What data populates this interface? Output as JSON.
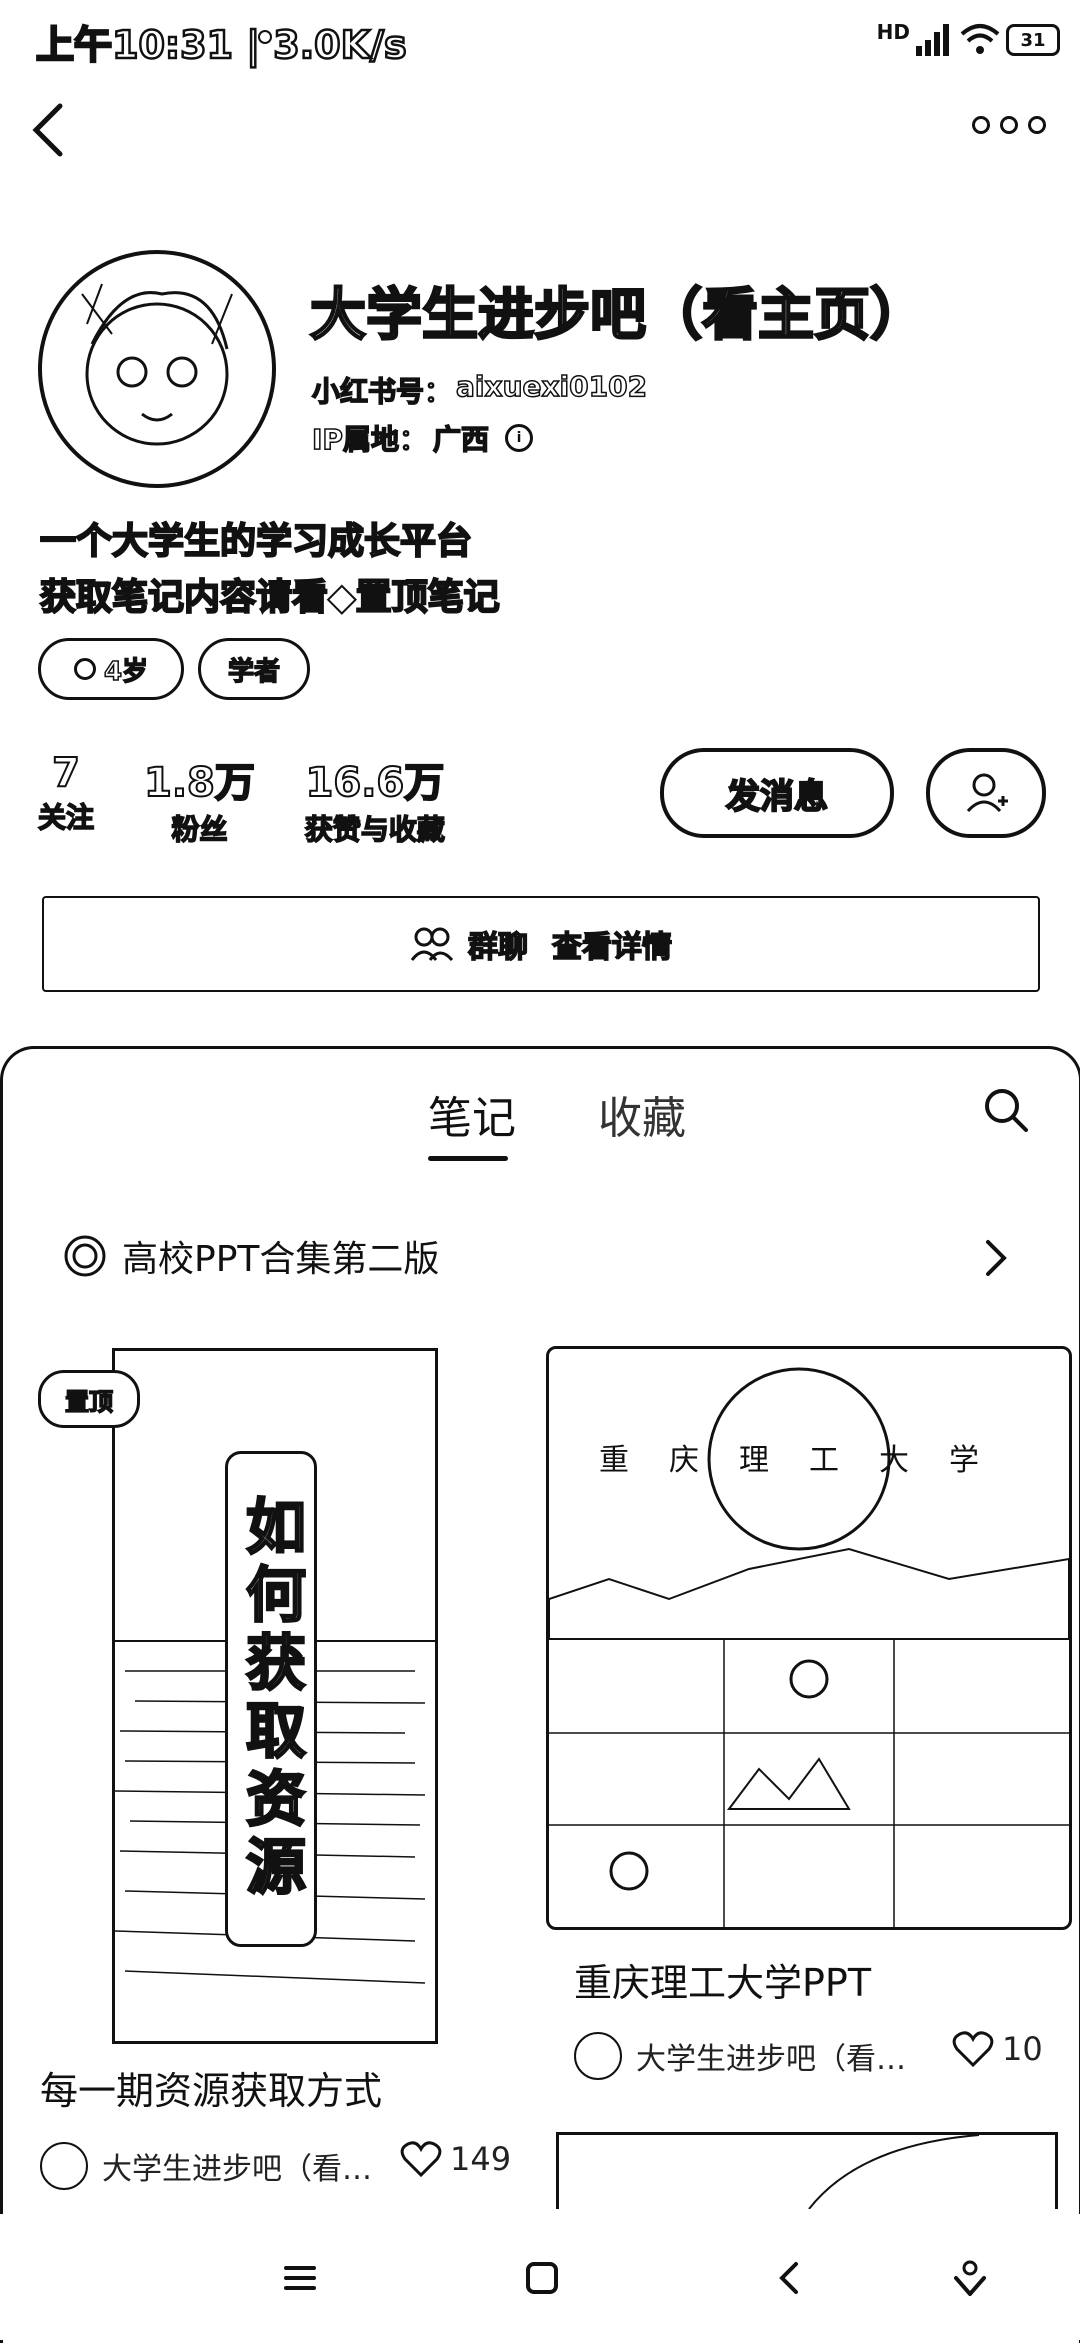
{
  "status": {
    "time_speed": "上午10:31 | 3.0K/s",
    "hd": "HD",
    "battery": "31"
  },
  "profile": {
    "name": "大学生进步吧（看主页）",
    "id_label": "小红书号：",
    "id_value": "aixuexi0102",
    "ip_label": "IP属地：",
    "ip_value": "广西",
    "bio_lines": [
      "一个大学生的学习成长平台",
      "获取笔记内容请看◆置顶笔记"
    ],
    "tags": [
      "4岁",
      "学者"
    ],
    "stats": [
      {
        "value": "7",
        "label": "关注"
      },
      {
        "value": "1.8万",
        "label": "粉丝"
      },
      {
        "value": "16.6万",
        "label": "获赞与收藏"
      }
    ],
    "message_button": "发消息",
    "group": {
      "label": "群聊",
      "detail": "查看详情"
    }
  },
  "tabs": {
    "notes": "笔记",
    "favorites": "收藏"
  },
  "collection": {
    "title": "高校PPT合集第二版"
  },
  "cards": [
    {
      "badge": "置顶",
      "cover_text": "如何获取资源",
      "title": "每一期资源获取方式",
      "author": "大学生进步吧（看…",
      "likes": "149"
    },
    {
      "cover_title": "重庆理工大学",
      "title": "重庆理工大学PPT",
      "author": "大学生进步吧（看…",
      "likes": "10"
    }
  ]
}
